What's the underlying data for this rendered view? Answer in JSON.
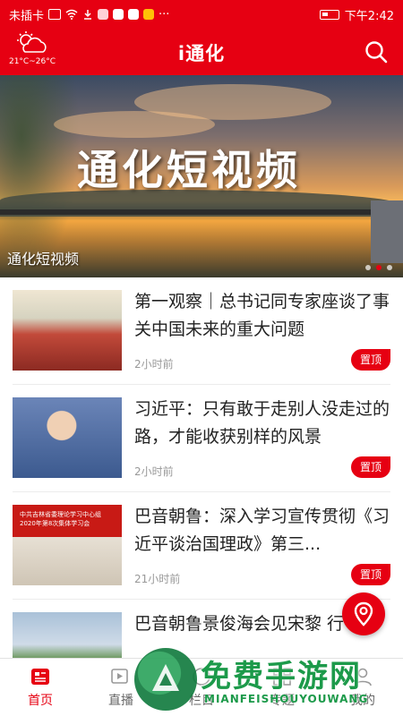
{
  "status_bar": {
    "carrier": "未插卡",
    "time": "下午2:42",
    "overflow": "···"
  },
  "header": {
    "title": "i通化",
    "weather_temp": "21°C~26°C",
    "weather_icon": "cloudy-icon",
    "search_icon": "search-icon"
  },
  "banner": {
    "overlay_title": "通化短视频",
    "caption": "通化短视频",
    "slide_count": 3,
    "active_slide": 2
  },
  "news": [
    {
      "title": "第一观察｜总书记同专家座谈了事关中国未来的重大问题",
      "time": "2小时前",
      "badge": "置顶"
    },
    {
      "title": "习近平：只有敢于走别人没走过的路，才能收获别样的风景",
      "time": "2小时前",
      "badge": "置顶"
    },
    {
      "title": "巴音朝鲁：深入学习宣传贯彻《习近平谈治国理政》第三...",
      "time": "21小时前",
      "badge": "置顶",
      "thumb_text_1": "中共吉林省委理论学习中心组",
      "thumb_text_2": "2020年第8次集体学习会"
    },
    {
      "title": "巴音朝鲁景俊海会见宋黎 行",
      "time": "",
      "badge": ""
    }
  ],
  "bottom_nav": [
    {
      "label": "首页",
      "icon": "home-news-icon",
      "active": true
    },
    {
      "label": "直播",
      "icon": "live-icon",
      "active": false
    },
    {
      "label": "栏目",
      "icon": "column-icon",
      "active": false
    },
    {
      "label": "专题",
      "icon": "topic-icon",
      "active": false
    },
    {
      "label": "我的",
      "icon": "profile-icon",
      "active": false
    }
  ],
  "watermark": {
    "text": "免费手游网",
    "sub": "MIANFEISHOUYOUWANG"
  },
  "colors": {
    "brand_red": "#e60012",
    "watermark_green": "#1c9a4a"
  }
}
